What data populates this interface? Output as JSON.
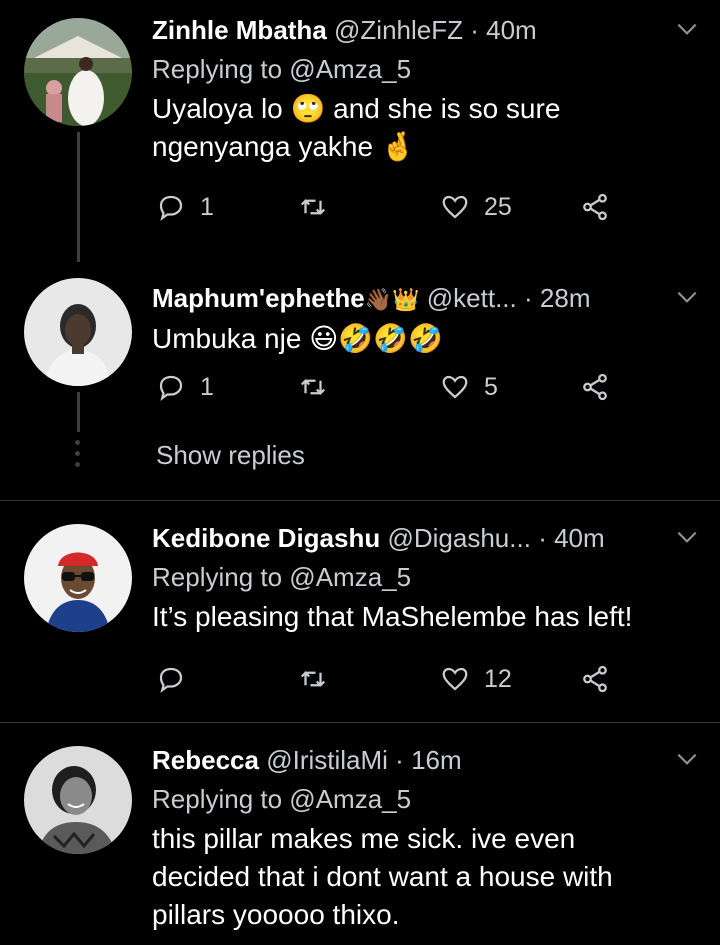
{
  "tweets": [
    {
      "name": "Zinhle Mbatha",
      "badges": "",
      "handle": "@ZinhleFZ",
      "sep": "·",
      "time": "40m",
      "replying": "Replying to @Amza_5",
      "text_line1": "Uyaloya lo 🙄 and she is so sure",
      "text_line2": "ngenyanga yakhe 🤞",
      "reply_count": "1",
      "retweet_count": "",
      "like_count": "25"
    },
    {
      "name": "Maphum'ephethe",
      "badges": "👋🏾👑",
      "handle": "@kett...",
      "sep": "·",
      "time": "28m",
      "replying": "",
      "text_line1": "Umbuka nje 😃🤣🤣🤣",
      "text_line2": "",
      "reply_count": "1",
      "retweet_count": "",
      "like_count": "5",
      "show_replies": "Show replies"
    },
    {
      "name": "Kedibone Digashu",
      "badges": "",
      "handle": "@Digashu...",
      "sep": "·",
      "time": "40m",
      "replying": "Replying to @Amza_5",
      "text_line1": "It’s pleasing that MaShelembe has left!",
      "text_line2": "",
      "reply_count": "",
      "retweet_count": "",
      "like_count": "12"
    },
    {
      "name": "Rebecca",
      "badges": "",
      "handle": "@IristilaMi",
      "sep": "·",
      "time": "16m",
      "replying": "Replying to @Amza_5",
      "text_line1": "this pillar makes me sick. ive even",
      "text_line2": "decided that i dont want a house with",
      "text_line3": "pillars yooooo thixo."
    }
  ],
  "colors": {
    "background": "#000000",
    "text": "#ffffff",
    "secondary": "#c8cdd2",
    "divider": "#2f3336"
  },
  "icons": [
    "reply-icon",
    "retweet-icon",
    "like-icon",
    "share-icon",
    "chevron-down-icon"
  ]
}
